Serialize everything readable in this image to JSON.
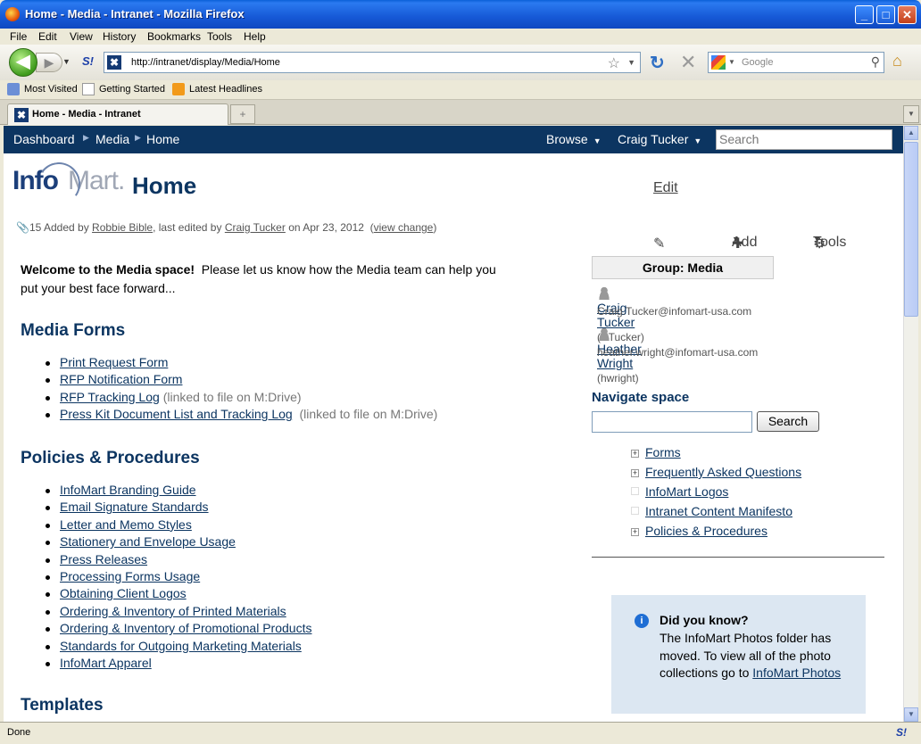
{
  "window": {
    "title": "Home - Media - Intranet - Mozilla Firefox"
  },
  "menu": [
    "File",
    "Edit",
    "View",
    "History",
    "Bookmarks",
    "Tools",
    "Help"
  ],
  "address": {
    "url": "http://intranet/display/Media/Home"
  },
  "browser_search": {
    "placeholder": "Google"
  },
  "bookmarks": [
    "Most Visited",
    "Getting Started",
    "Latest Headlines"
  ],
  "tab": {
    "label": "Home - Media - Intranet"
  },
  "status": "Done",
  "header": {
    "breadcrumbs": [
      "Dashboard",
      "Media",
      "Home"
    ],
    "browse": "Browse",
    "user": "Craig Tucker",
    "search_placeholder": "Search"
  },
  "page": {
    "logo_info": "Info",
    "logo_mart": "Mart.",
    "title": "Home",
    "actions": {
      "edit": "Edit",
      "add": "Add",
      "tools": "Tools"
    },
    "meta": {
      "count": "15",
      "added_by_prefix": "Added by",
      "added_by": "Robbie Bible",
      "edited_by_prefix": ", last edited by",
      "edited_by": "Craig Tucker",
      "date": "on Apr 23, 2012",
      "view_change": "view change"
    },
    "welcome_bold": "Welcome to the Media space!",
    "welcome_line1": "Please let us know how the Media team can help you",
    "welcome_line2": "put your best face forward...",
    "sections": {
      "forms": {
        "title": "Media Forms",
        "items": [
          {
            "label": "Print Request Form",
            "note": ""
          },
          {
            "label": "RFP Notification Form",
            "note": ""
          },
          {
            "label": "RFP Tracking Log",
            "note": "(linked to file on M:Drive)"
          },
          {
            "label": "Press Kit Document List and Tracking Log",
            "note": "(linked to file on M:Drive)"
          }
        ]
      },
      "policies": {
        "title": "Policies & Procedures",
        "items": [
          "InfoMart Branding Guide",
          "Email Signature Standards",
          "Letter and Memo Styles",
          "Stationery and Envelope Usage",
          "Press Releases",
          "Processing Forms Usage",
          "Obtaining Client Logos",
          "Ordering & Inventory of Printed Materials",
          "Ordering & Inventory of Promotional Products",
          "Standards for Outgoing Marketing Materials",
          "InfoMart Apparel"
        ]
      },
      "templates": {
        "title": "Templates"
      }
    }
  },
  "sidebar": {
    "group_title": "Group: Media",
    "members": [
      {
        "name": "Craig Tucker",
        "uid": "(CTucker)",
        "email": "Craig.Tucker@infomart-usa.com"
      },
      {
        "name": "Heather Wright",
        "uid": "(hwright)",
        "email": "heather.wright@infomart-usa.com"
      }
    ],
    "navigate_title": "Navigate space",
    "search_button": "Search",
    "tree": [
      {
        "label": "Forms",
        "expand": "+"
      },
      {
        "label": "Frequently Asked Questions",
        "expand": "+"
      },
      {
        "label": "InfoMart Logos",
        "expand": ""
      },
      {
        "label": "Intranet Content Manifesto",
        "expand": ""
      },
      {
        "label": "Policies & Procedures",
        "expand": "+"
      }
    ],
    "tip": {
      "title": "Did you know?",
      "body": "The InfoMart Photos folder has moved. To view all of the photo collections go to",
      "link": "InfoMart Photos"
    }
  }
}
